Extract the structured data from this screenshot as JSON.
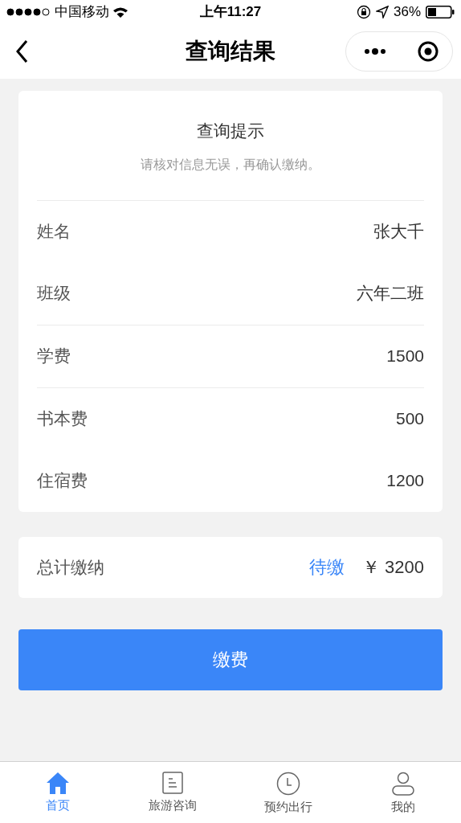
{
  "status_bar": {
    "carrier": "中国移动",
    "time": "上午11:27",
    "battery": "36%"
  },
  "nav": {
    "title": "查询结果"
  },
  "notice": {
    "title": "查询提示",
    "subtitle": "请核对信息无误，再确认缴纳。"
  },
  "groups": [
    {
      "rows": [
        {
          "label": "姓名",
          "value": "张大千"
        },
        {
          "label": "班级",
          "value": "六年二班"
        }
      ]
    },
    {
      "rows": [
        {
          "label": "学费",
          "value": "1500"
        }
      ]
    },
    {
      "rows": [
        {
          "label": "书本费",
          "value": "500"
        },
        {
          "label": "住宿费",
          "value": "1200"
        }
      ]
    }
  ],
  "total": {
    "label": "总计缴纳",
    "status": "待缴",
    "amount": "￥ 3200"
  },
  "pay_button": "缴费",
  "tabs": [
    {
      "label": "首页",
      "selected": true
    },
    {
      "label": "旅游咨询",
      "selected": false
    },
    {
      "label": "预约出行",
      "selected": false
    },
    {
      "label": "我的",
      "selected": false
    }
  ]
}
